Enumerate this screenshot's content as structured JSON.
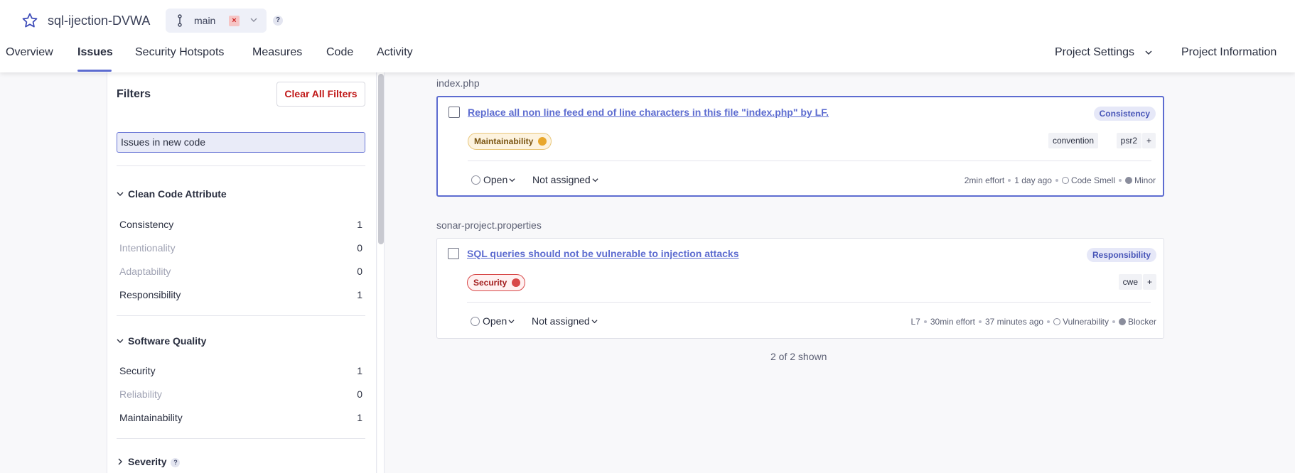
{
  "header": {
    "project_name": "sql-ijection-DVWA",
    "branch": "main",
    "help": "?",
    "tabs": [
      {
        "label": "Overview"
      },
      {
        "label": "Issues"
      },
      {
        "label": "Security Hotspots"
      },
      {
        "label": "Measures"
      },
      {
        "label": "Code"
      },
      {
        "label": "Activity"
      }
    ],
    "project_settings": "Project Settings",
    "project_information": "Project Information"
  },
  "filters": {
    "title": "Filters",
    "clear_all": "Clear All Filters",
    "new_code": "Issues in new code",
    "clean_code_attribute": {
      "title": "Clean Code Attribute",
      "items": [
        {
          "label": "Consistency",
          "count": "1"
        },
        {
          "label": "Intentionality",
          "count": "0"
        },
        {
          "label": "Adaptability",
          "count": "0"
        },
        {
          "label": "Responsibility",
          "count": "1"
        }
      ]
    },
    "software_quality": {
      "title": "Software Quality",
      "items": [
        {
          "label": "Security",
          "count": "1"
        },
        {
          "label": "Reliability",
          "count": "0"
        },
        {
          "label": "Maintainability",
          "count": "1"
        }
      ]
    },
    "severity": {
      "title": "Severity",
      "help": "?"
    }
  },
  "issues": [
    {
      "file": "index.php",
      "title": "Replace all non line feed end of line characters in this file \"index.php\" by LF.",
      "attribute": "Consistency",
      "quality": "Maintainability",
      "tags": [
        "convention",
        "psr2",
        "+"
      ],
      "status": "Open",
      "assignee": "Not assigned",
      "effort": "2min effort",
      "age": "1 day ago",
      "type": "Code Smell",
      "severity": "Minor"
    },
    {
      "file": "sonar-project.properties",
      "title": "SQL queries should not be vulnerable to injection attacks",
      "attribute": "Responsibility",
      "quality": "Security",
      "tags": [
        "cwe",
        "+"
      ],
      "status": "Open",
      "assignee": "Not assigned",
      "line": "L7",
      "effort": "30min effort",
      "age": "37 minutes ago",
      "type": "Vulnerability",
      "severity": "Blocker"
    }
  ],
  "footer": {
    "shown": "2 of 2 shown"
  },
  "colors": {
    "accent": "#5d6cd0",
    "danger": "#c01818",
    "maintainability": "#e8a72c",
    "security": "#d84848"
  }
}
